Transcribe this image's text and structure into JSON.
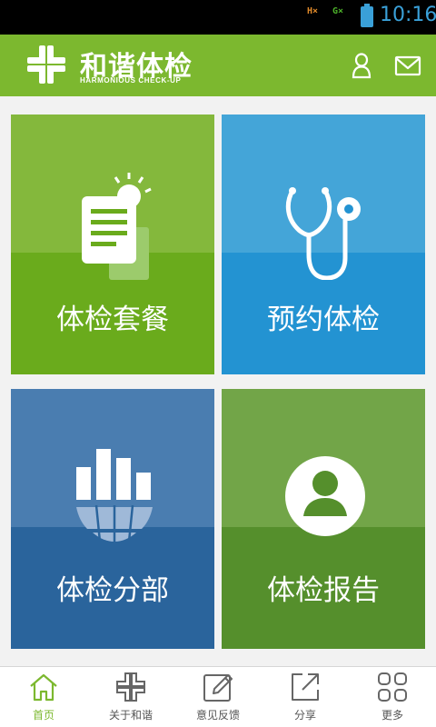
{
  "status_bar": {
    "signal1": "H×",
    "signal2": "G×",
    "time": "10:16"
  },
  "header": {
    "logo_cn": "和谐体检",
    "logo_en": "HARMONIOUS CHECK-UP",
    "brand_color": "#7cb82f",
    "icons": [
      "user-icon",
      "mail-icon"
    ]
  },
  "tiles": [
    {
      "label": "体检套餐",
      "icon": "document-icon"
    },
    {
      "label": "预约体检",
      "icon": "stethoscope-icon"
    },
    {
      "label": "体检分部",
      "icon": "building-globe-icon"
    },
    {
      "label": "体检报告",
      "icon": "person-icon"
    }
  ],
  "nav": [
    {
      "label": "首页",
      "icon": "home-icon",
      "active": true
    },
    {
      "label": "关于和谐",
      "icon": "about-logo-icon",
      "active": false
    },
    {
      "label": "意见反馈",
      "icon": "edit-icon",
      "active": false
    },
    {
      "label": "分享",
      "icon": "share-icon",
      "active": false
    },
    {
      "label": "更多",
      "icon": "grid-icon",
      "active": false
    }
  ]
}
